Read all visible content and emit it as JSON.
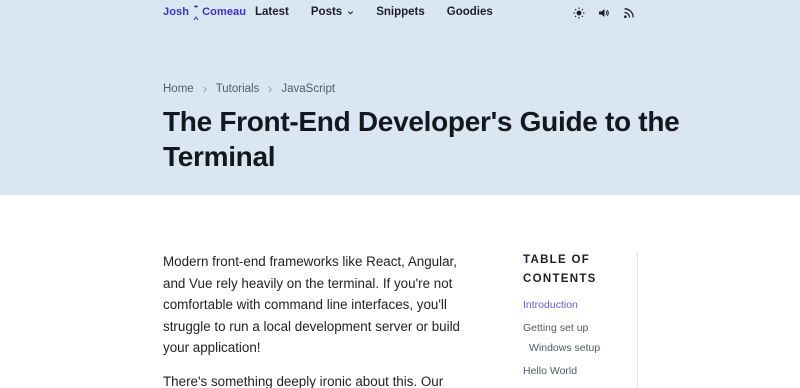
{
  "nav": {
    "logo_first": "Josh",
    "logo_last": "Comeau",
    "links": [
      {
        "label": "Latest"
      },
      {
        "label": "Posts"
      },
      {
        "label": "Snippets"
      },
      {
        "label": "Goodies"
      }
    ],
    "icons": [
      "sun-icon",
      "speaker-icon",
      "rss-icon"
    ]
  },
  "breadcrumb": [
    "Home",
    "Tutorials",
    "JavaScript"
  ],
  "title": "The Front-End Developer's Guide to the Terminal",
  "article": {
    "paragraphs": [
      "Modern front-end frameworks like React, Angular, and Vue rely heavily on the terminal. If you're not comfortable with command line interfaces, you'll struggle to run a local development server or build your application!",
      "There's something deeply ironic about this. Our"
    ]
  },
  "toc": {
    "heading": "TABLE OF CONTENTS",
    "items": [
      {
        "label": "Introduction",
        "active": true
      },
      {
        "label": "Getting set up"
      },
      {
        "label": "Windows setup",
        "sub": true
      },
      {
        "label": "Hello World"
      }
    ]
  },
  "colors": {
    "hero_bg": "#dbe6f3",
    "logo": "#3d2fd1",
    "toc_active": "#6b5bd6"
  }
}
